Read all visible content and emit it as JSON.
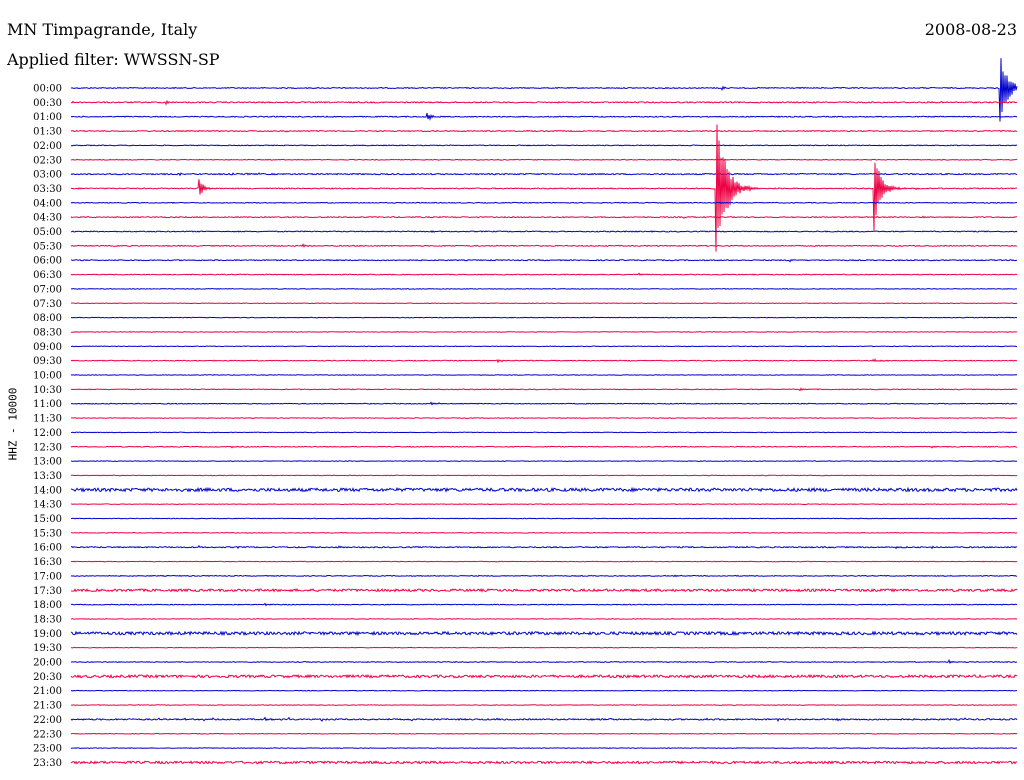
{
  "header": {
    "station": "MN Timpagrande, Italy",
    "filter": "Applied filter: WWSSN-SP",
    "date": "2008-08-23",
    "channel": "HHZ - 10000"
  },
  "chart_data": {
    "type": "line",
    "title": "MN Timpagrande, Italy",
    "subtitle": "Applied filter: WWSSN-SP",
    "date": "2008-08-23",
    "ylabel": "HHZ - 10000",
    "xlabel": "",
    "colors": [
      "#0000cc",
      "#ee0044"
    ],
    "grid": false,
    "legend": "none",
    "row_minutes": 30,
    "traces": [
      {
        "label": "00:00",
        "noise": 0.5,
        "events": [
          {
            "t": 0.688,
            "amp": 3,
            "dur": 0.004
          },
          {
            "t": 0.982,
            "amp": 43,
            "dur": 0.016
          }
        ]
      },
      {
        "label": "00:30",
        "noise": 0.6,
        "events": [
          {
            "t": 0.002,
            "amp": 2,
            "dur": 0.003
          },
          {
            "t": 0.1,
            "amp": 2.5,
            "dur": 0.006
          }
        ]
      },
      {
        "label": "01:00",
        "noise": 0.5,
        "events": [
          {
            "t": 0.376,
            "amp": 5,
            "dur": 0.01
          }
        ]
      },
      {
        "label": "01:30",
        "noise": 0.5,
        "events": [
          {
            "t": 0.227,
            "amp": 1.5,
            "dur": 0.004
          },
          {
            "t": 0.48,
            "amp": 1.5,
            "dur": 0.004
          }
        ]
      },
      {
        "label": "02:00",
        "noise": 0.4,
        "events": []
      },
      {
        "label": "02:30",
        "noise": 0.4,
        "events": []
      },
      {
        "label": "03:00",
        "noise": 0.6,
        "events": [
          {
            "t": 0.115,
            "amp": 1.5,
            "dur": 0.003
          },
          {
            "t": 0.17,
            "amp": 1.5,
            "dur": 0.003
          },
          {
            "t": 0.185,
            "amp": 1.5,
            "dur": 0.003
          },
          {
            "t": 0.198,
            "amp": 1.5,
            "dur": 0.003
          }
        ]
      },
      {
        "label": "03:30",
        "noise": 0.5,
        "events": [
          {
            "t": 0.135,
            "amp": 14,
            "dur": 0.008
          },
          {
            "t": 0.681,
            "amp": 95,
            "dur": 0.02
          },
          {
            "t": 0.848,
            "amp": 50,
            "dur": 0.014
          },
          {
            "t": 0.893,
            "amp": 2,
            "dur": 0.003
          }
        ]
      },
      {
        "label": "04:00",
        "noise": 0.4,
        "events": []
      },
      {
        "label": "04:30",
        "noise": 0.5,
        "events": [
          {
            "t": 0.235,
            "amp": 1.5,
            "dur": 0.003
          },
          {
            "t": 0.647,
            "amp": 1.5,
            "dur": 0.003
          },
          {
            "t": 0.9,
            "amp": 1.5,
            "dur": 0.003
          }
        ]
      },
      {
        "label": "05:00",
        "noise": 0.5,
        "events": [
          {
            "t": 0.38,
            "amp": 2,
            "dur": 0.003
          }
        ]
      },
      {
        "label": "05:30",
        "noise": 0.5,
        "events": [
          {
            "t": 0.245,
            "amp": 2.5,
            "dur": 0.005
          }
        ]
      },
      {
        "label": "06:00",
        "noise": 0.5,
        "events": [
          {
            "t": 0.145,
            "amp": 1.5,
            "dur": 0.003
          },
          {
            "t": 0.27,
            "amp": 1.5,
            "dur": 0.003
          },
          {
            "t": 0.44,
            "amp": 1.5,
            "dur": 0.003
          },
          {
            "t": 0.76,
            "amp": 1.5,
            "dur": 0.005
          }
        ]
      },
      {
        "label": "06:30",
        "noise": 0.4,
        "events": [
          {
            "t": 0.6,
            "amp": 1.2,
            "dur": 0.012
          }
        ]
      },
      {
        "label": "07:00",
        "noise": 0.3,
        "events": []
      },
      {
        "label": "07:30",
        "noise": 0.3,
        "events": []
      },
      {
        "label": "08:00",
        "noise": 0.3,
        "events": []
      },
      {
        "label": "08:30",
        "noise": 0.3,
        "events": []
      },
      {
        "label": "09:00",
        "noise": 0.3,
        "events": []
      },
      {
        "label": "09:30",
        "noise": 0.4,
        "events": [
          {
            "t": 0.45,
            "amp": 1.5,
            "dur": 0.016
          },
          {
            "t": 0.847,
            "amp": 1.5,
            "dur": 0.02
          }
        ]
      },
      {
        "label": "10:00",
        "noise": 0.3,
        "events": []
      },
      {
        "label": "10:30",
        "noise": 0.4,
        "events": [
          {
            "t": 0.77,
            "amp": 1.2,
            "dur": 0.016
          }
        ]
      },
      {
        "label": "11:00",
        "noise": 0.4,
        "events": [
          {
            "t": 0.38,
            "amp": 1.5,
            "dur": 0.02
          }
        ]
      },
      {
        "label": "11:30",
        "noise": 0.3,
        "events": []
      },
      {
        "label": "12:00",
        "noise": 0.3,
        "events": []
      },
      {
        "label": "12:30",
        "noise": 0.4,
        "events": [
          {
            "t": 0.17,
            "amp": 1.2,
            "dur": 0.003
          },
          {
            "t": 0.91,
            "amp": 1.2,
            "dur": 0.008
          },
          {
            "t": 0.97,
            "amp": 1.2,
            "dur": 0.003
          }
        ]
      },
      {
        "label": "13:00",
        "noise": 0.3,
        "events": []
      },
      {
        "label": "13:30",
        "noise": 0.3,
        "events": []
      },
      {
        "label": "14:00",
        "noise": 1.6,
        "events": []
      },
      {
        "label": "14:30",
        "noise": 0.3,
        "events": []
      },
      {
        "label": "15:00",
        "noise": 0.3,
        "events": []
      },
      {
        "label": "15:30",
        "noise": 0.3,
        "events": []
      },
      {
        "label": "16:00",
        "noise": 0.6,
        "events": [
          {
            "t": 0.135,
            "amp": 1.3,
            "dur": 0.003
          },
          {
            "t": 0.176,
            "amp": 1.3,
            "dur": 0.003
          },
          {
            "t": 0.255,
            "amp": 1.3,
            "dur": 0.003
          },
          {
            "t": 0.283,
            "amp": 1.3,
            "dur": 0.003
          },
          {
            "t": 0.3,
            "amp": 1.3,
            "dur": 0.003
          },
          {
            "t": 0.31,
            "amp": 1.3,
            "dur": 0.003
          },
          {
            "t": 0.49,
            "amp": 1.3,
            "dur": 0.003
          },
          {
            "t": 0.714,
            "amp": 1.3,
            "dur": 0.003
          },
          {
            "t": 0.8,
            "amp": 1.3,
            "dur": 0.003
          },
          {
            "t": 0.872,
            "amp": 1.3,
            "dur": 0.003
          },
          {
            "t": 0.91,
            "amp": 1.3,
            "dur": 0.003
          }
        ]
      },
      {
        "label": "16:30",
        "noise": 0.3,
        "events": []
      },
      {
        "label": "17:00",
        "noise": 0.4,
        "events": [
          {
            "t": 0.637,
            "amp": 1.5,
            "dur": 0.01
          }
        ]
      },
      {
        "label": "17:30",
        "noise": 1.2,
        "events": []
      },
      {
        "label": "18:00",
        "noise": 0.4,
        "events": [
          {
            "t": 0.205,
            "amp": 1.5,
            "dur": 0.006
          }
        ]
      },
      {
        "label": "18:30",
        "noise": 0.3,
        "events": []
      },
      {
        "label": "19:00",
        "noise": 1.5,
        "events": []
      },
      {
        "label": "19:30",
        "noise": 0.3,
        "events": []
      },
      {
        "label": "20:00",
        "noise": 0.4,
        "events": [
          {
            "t": 0.928,
            "amp": 2,
            "dur": 0.005
          }
        ]
      },
      {
        "label": "20:30",
        "noise": 1.3,
        "events": []
      },
      {
        "label": "21:00",
        "noise": 0.3,
        "events": []
      },
      {
        "label": "21:30",
        "noise": 0.3,
        "events": []
      },
      {
        "label": "22:00",
        "noise": 0.7,
        "events": [
          {
            "t": 0.093,
            "amp": 1.5,
            "dur": 0.003
          },
          {
            "t": 0.12,
            "amp": 1.5,
            "dur": 0.004
          },
          {
            "t": 0.14,
            "amp": 1.5,
            "dur": 0.004
          },
          {
            "t": 0.15,
            "amp": 1.5,
            "dur": 0.003
          },
          {
            "t": 0.205,
            "amp": 1.5,
            "dur": 0.003
          },
          {
            "t": 0.23,
            "amp": 1.5,
            "dur": 0.003
          },
          {
            "t": 0.265,
            "amp": 1.5,
            "dur": 0.003
          },
          {
            "t": 0.31,
            "amp": 1.5,
            "dur": 0.003
          },
          {
            "t": 0.36,
            "amp": 1.5,
            "dur": 0.003
          },
          {
            "t": 0.45,
            "amp": 1.5,
            "dur": 0.003
          },
          {
            "t": 0.55,
            "amp": 1.5,
            "dur": 0.003
          },
          {
            "t": 0.57,
            "amp": 1.5,
            "dur": 0.003
          },
          {
            "t": 0.59,
            "amp": 1.5,
            "dur": 0.003
          },
          {
            "t": 0.672,
            "amp": 1.5,
            "dur": 0.003
          },
          {
            "t": 0.747,
            "amp": 1.5,
            "dur": 0.003
          },
          {
            "t": 0.81,
            "amp": 1.5,
            "dur": 0.003
          },
          {
            "t": 0.945,
            "amp": 1.5,
            "dur": 0.003
          },
          {
            "t": 0.97,
            "amp": 1.5,
            "dur": 0.003
          }
        ]
      },
      {
        "label": "22:30",
        "noise": 0.3,
        "events": []
      },
      {
        "label": "23:00",
        "noise": 0.3,
        "events": []
      },
      {
        "label": "23:30",
        "noise": 1.2,
        "events": []
      }
    ]
  }
}
